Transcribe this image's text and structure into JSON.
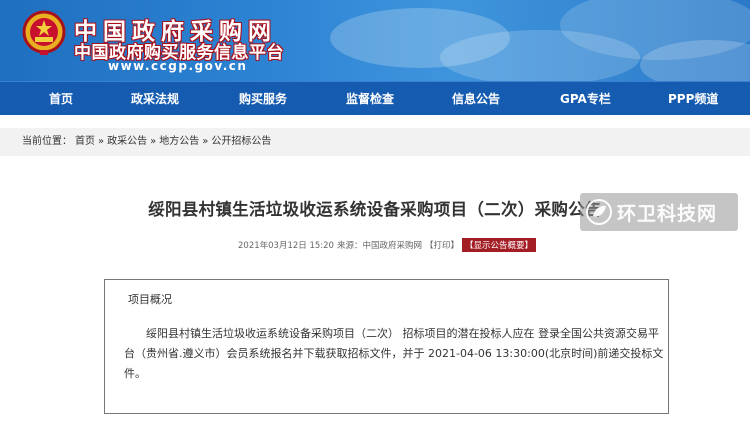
{
  "header": {
    "site_name": "中国政府采购网",
    "site_subname": "中国政府购买服务信息平台",
    "site_url": "www.ccgp.gov.cn",
    "brand_color": "#1f6fc0",
    "emblem_accent": "#c8102e"
  },
  "nav": {
    "items": [
      {
        "label": "首页"
      },
      {
        "label": "政采法规"
      },
      {
        "label": "购买服务"
      },
      {
        "label": "监督检查"
      },
      {
        "label": "信息公告"
      },
      {
        "label": "GPA专栏"
      },
      {
        "label": "PPP频道"
      }
    ],
    "bg_color": "#155bb0"
  },
  "breadcrumb": {
    "prefix": "当前位置：",
    "items": [
      "首页",
      "政采公告",
      "地方公告",
      "公开招标公告"
    ],
    "separator": "»"
  },
  "article": {
    "title": "绥阳县村镇生活垃圾收运系统设备采购项目（二次）采购公告",
    "meta": {
      "date": "2021年03月12日 15:20",
      "source": "来源：中国政府采购网",
      "print_label": "【打印】",
      "summary_label": "【显示公告概要】"
    },
    "overview_heading": "项目概况",
    "body": "绥阳县村镇生活垃圾收运系统设备采购项目（二次） 招标项目的潜在投标人应在 登录全国公共资源交易平台（贵州省.遵义市）会员系统报名并下载获取招标文件，并于 2021-04-06 13:30:00(北京时间)前递交投标文件。"
  },
  "watermark": {
    "text": "环卫科技网",
    "icon": "leaf-logo-icon"
  }
}
